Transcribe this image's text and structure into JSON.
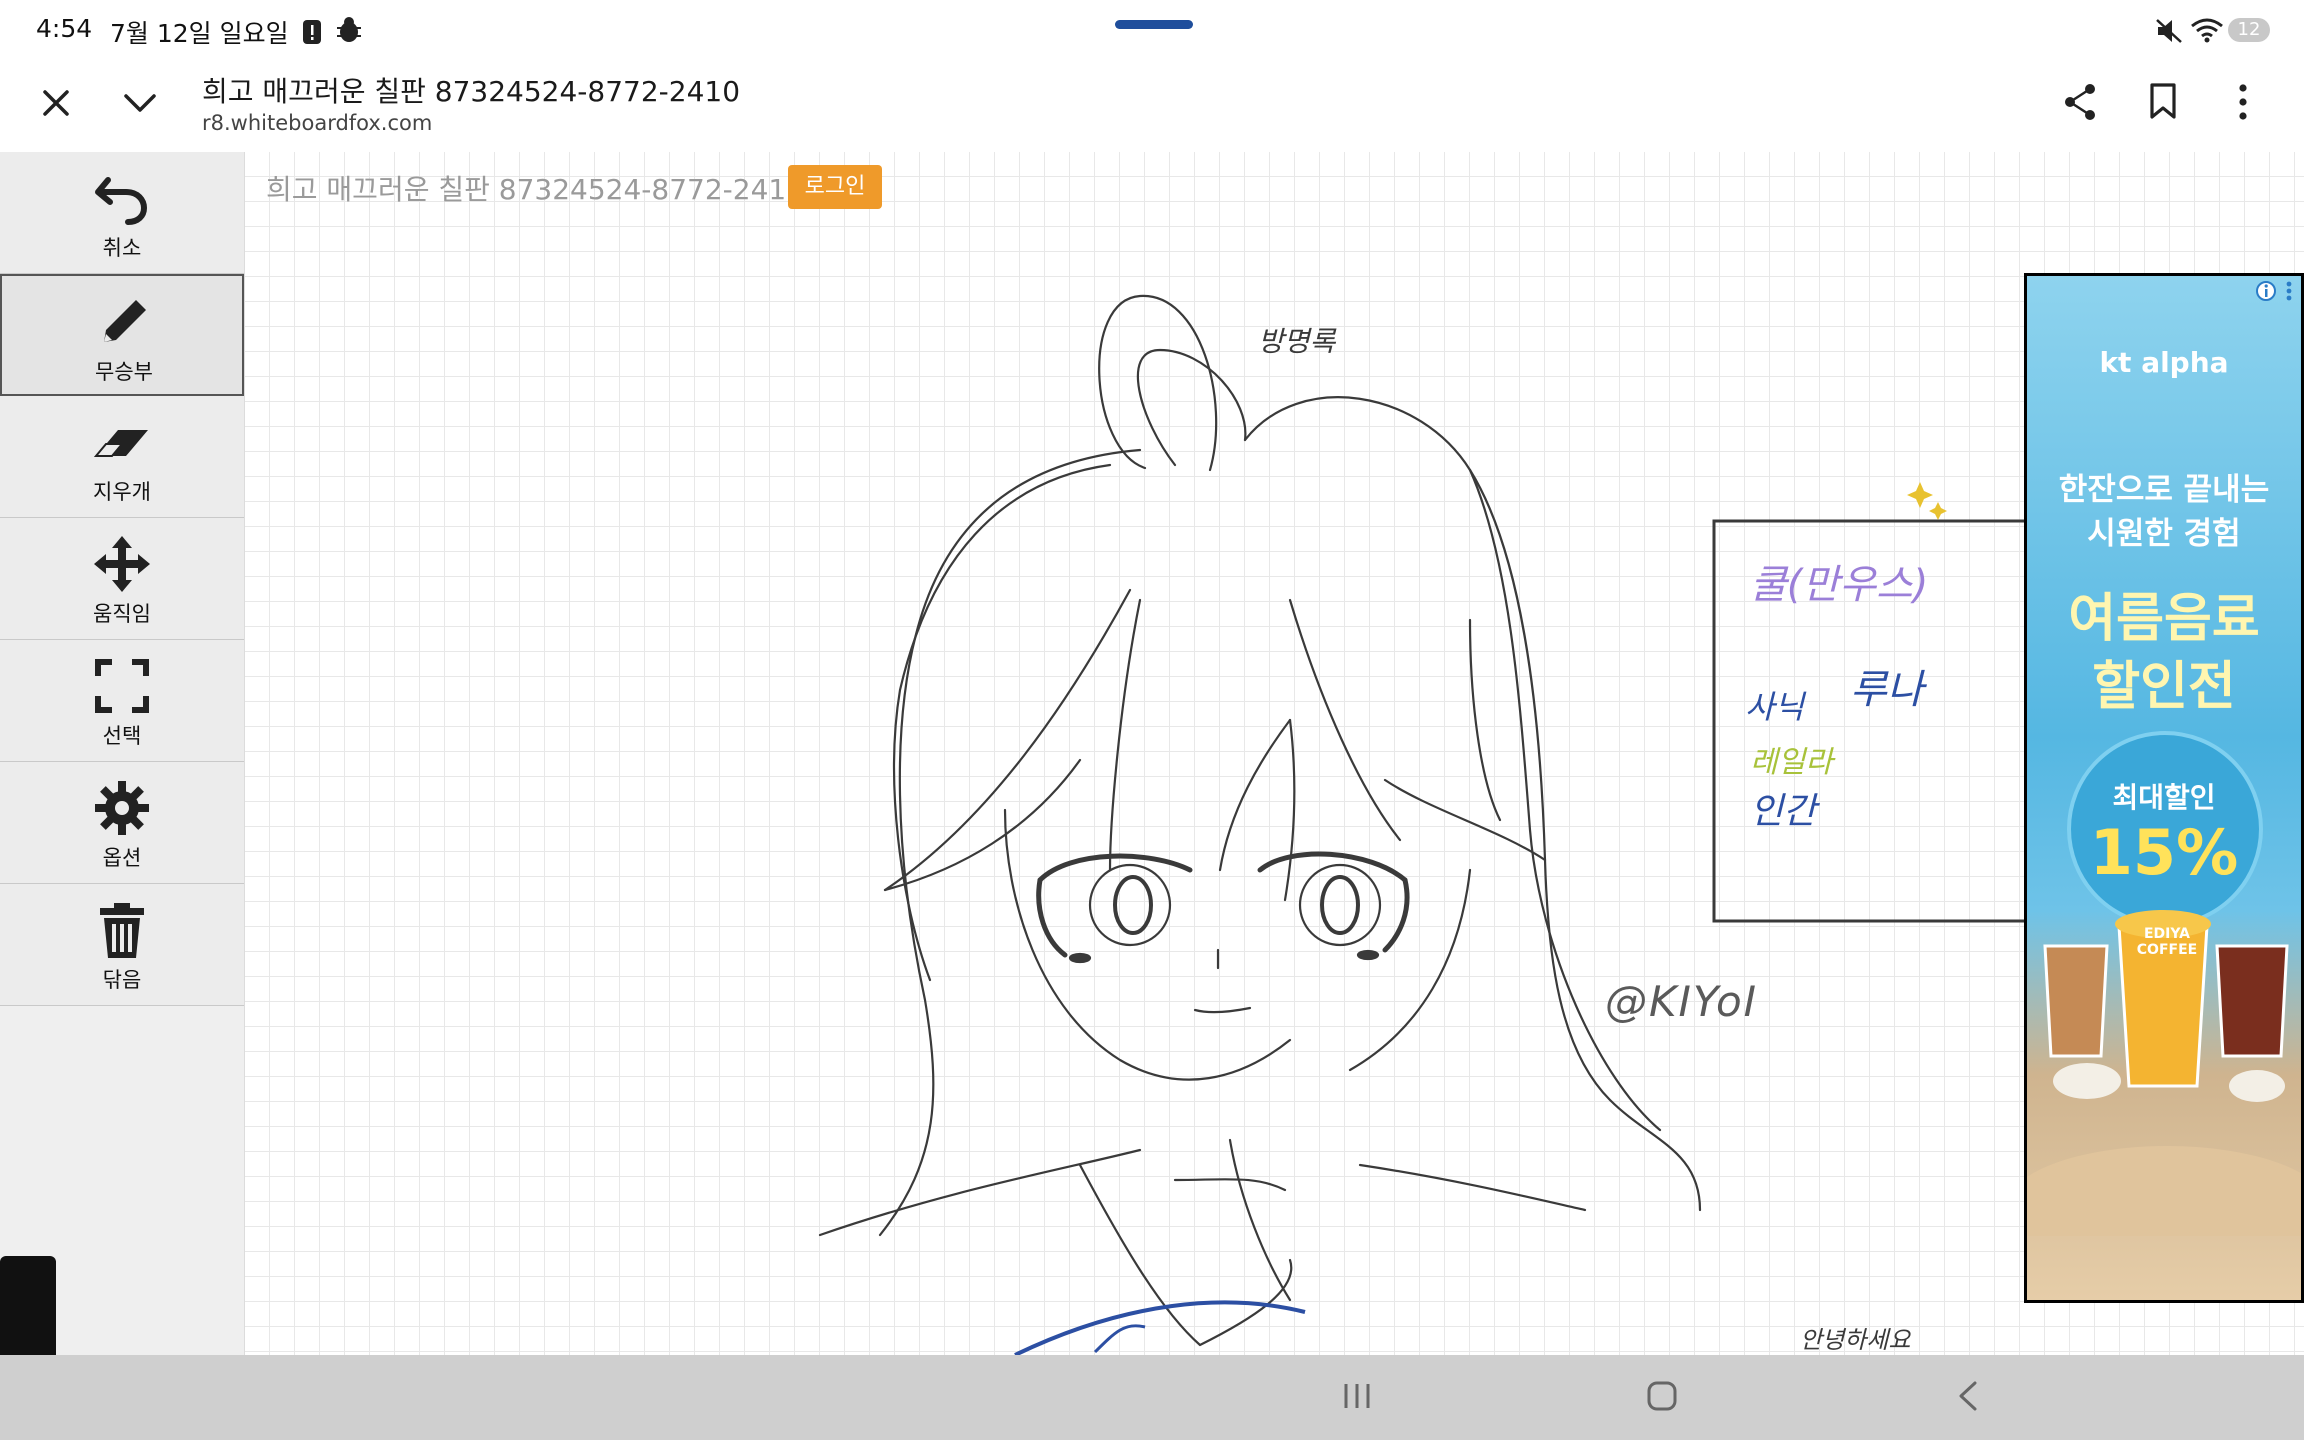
{
  "status_bar": {
    "time": "4:54",
    "date": "7월 12일 일요일",
    "battery": "12"
  },
  "browser": {
    "title": "희고 매끄러운 칠판 87324524-8772-2410",
    "url": "r8.whiteboardfox.com",
    "icons": [
      "close-icon",
      "chevron-down-icon",
      "share-icon",
      "bookmark-icon",
      "more-vert-icon"
    ]
  },
  "toolbar": {
    "items": [
      {
        "label": "취소",
        "icon": "undo-icon"
      },
      {
        "label": "무승부",
        "icon": "pencil-icon"
      },
      {
        "label": "지우개",
        "icon": "eraser-icon"
      },
      {
        "label": "움직임",
        "icon": "move-icon"
      },
      {
        "label": "선택",
        "icon": "select-icon"
      },
      {
        "label": "옵션",
        "icon": "gear-icon"
      },
      {
        "label": "닦음",
        "icon": "trash-icon"
      }
    ],
    "active_item": "무승부"
  },
  "board": {
    "title": "희고 매끄러운 칠판 87324524-8772-241",
    "login_label": "로그인",
    "login_color": "#ef9a2a"
  },
  "drawing": {
    "guestbook_title": "방명록",
    "entries": [
      {
        "text": "쿨(만우스)",
        "color": "#9b7fd8"
      },
      {
        "text": "사닉",
        "color": "#2c4fa3"
      },
      {
        "text": "루나",
        "color": "#2c4fa3"
      },
      {
        "text": "레일라",
        "color": "#a8c23a"
      },
      {
        "text": "인간",
        "color": "#2c4fa3"
      }
    ],
    "signature": "@KIYoI",
    "bottom_text": "안녕하세요"
  },
  "ad": {
    "brand": "kt alpha",
    "line1": "한잔으로 끝내는",
    "line2": "시원한 경험",
    "headline1": "여름음료",
    "headline2": "할인전",
    "discount_label": "최대할인",
    "discount_value": "15%",
    "cup_label": "EDIYA COFFEE"
  }
}
